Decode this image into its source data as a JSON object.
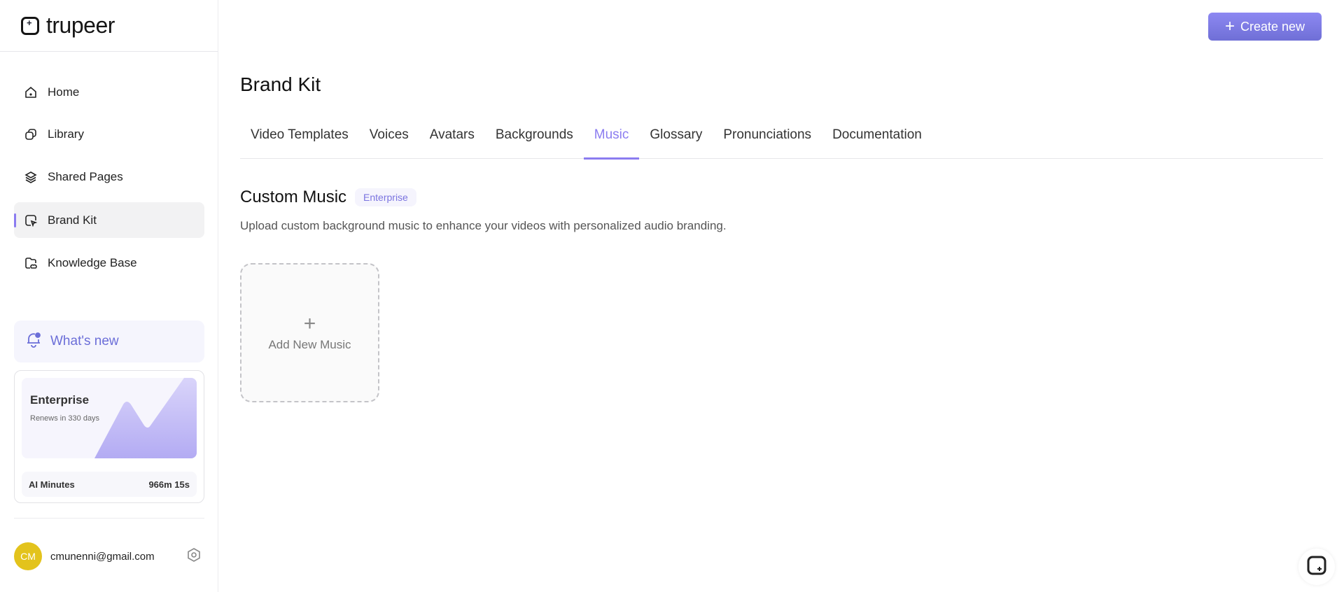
{
  "brand": {
    "name": "trupeer"
  },
  "sidebar": {
    "items": [
      {
        "label": "Home",
        "icon": "home-icon"
      },
      {
        "label": "Library",
        "icon": "library-icon"
      },
      {
        "label": "Shared Pages",
        "icon": "layers-icon"
      },
      {
        "label": "Brand Kit",
        "icon": "brand-kit-icon",
        "active": true
      },
      {
        "label": "Knowledge Base",
        "icon": "folder-icon"
      }
    ],
    "whats_new": "What's new",
    "plan": {
      "name": "Enterprise",
      "renews": "Renews in 330 days",
      "minutes_label": "AI Minutes",
      "minutes_value": "966m 15s"
    },
    "user": {
      "initials": "CM",
      "email": "cmunenni@gmail.com"
    }
  },
  "header": {
    "create_label": "Create new"
  },
  "page": {
    "title": "Brand Kit",
    "tabs": [
      "Video Templates",
      "Voices",
      "Avatars",
      "Backgrounds",
      "Music",
      "Glossary",
      "Pronunciations",
      "Documentation"
    ],
    "active_tab": "Music",
    "section": {
      "title": "Custom Music",
      "badge": "Enterprise",
      "description": "Upload custom background music to enhance your videos with personalized audio branding.",
      "add_label": "Add New Music"
    }
  },
  "colors": {
    "accent": "#8b7cf0",
    "avatar": "#e3c31c"
  }
}
